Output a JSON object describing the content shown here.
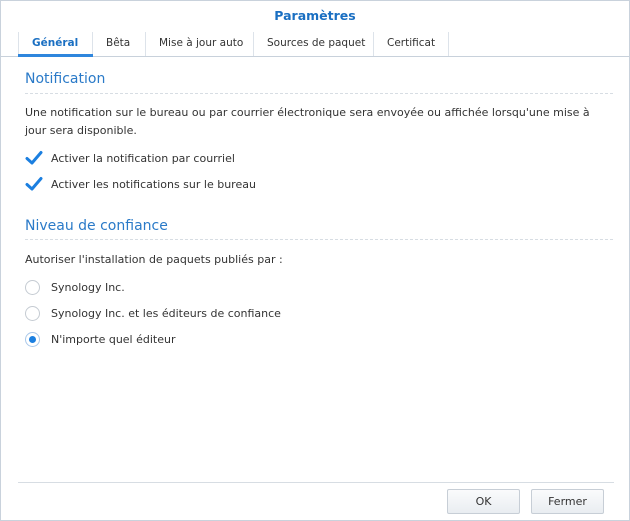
{
  "window": {
    "title": "Paramètres"
  },
  "tabs": [
    {
      "label": "Général",
      "active": true
    },
    {
      "label": "Bêta",
      "active": false
    },
    {
      "label": "Mise à jour auto",
      "active": false
    },
    {
      "label": "Sources de paquet",
      "active": false
    },
    {
      "label": "Certificat",
      "active": false
    }
  ],
  "notification": {
    "title": "Notification",
    "description_line1": "Une notification sur le bureau ou par courrier électronique sera envoyée ou affichée lorsqu'une mise à",
    "description_line2": "jour sera disponible.",
    "options": [
      {
        "label": "Activer la notification par courriel",
        "checked": true
      },
      {
        "label": "Activer les notifications sur le bureau",
        "checked": true
      }
    ]
  },
  "trust": {
    "title": "Niveau de confiance",
    "description": "Autoriser l'installation de paquets publiés par :",
    "options": [
      {
        "label": "Synology Inc.",
        "selected": false
      },
      {
        "label": "Synology Inc. et les éditeurs de confiance",
        "selected": false
      },
      {
        "label": "N'importe quel éditeur",
        "selected": true
      }
    ]
  },
  "footer": {
    "ok_label": "OK",
    "close_label": "Fermer"
  },
  "colors": {
    "accent": "#1a6fc2",
    "check": "#1b7fe0"
  }
}
